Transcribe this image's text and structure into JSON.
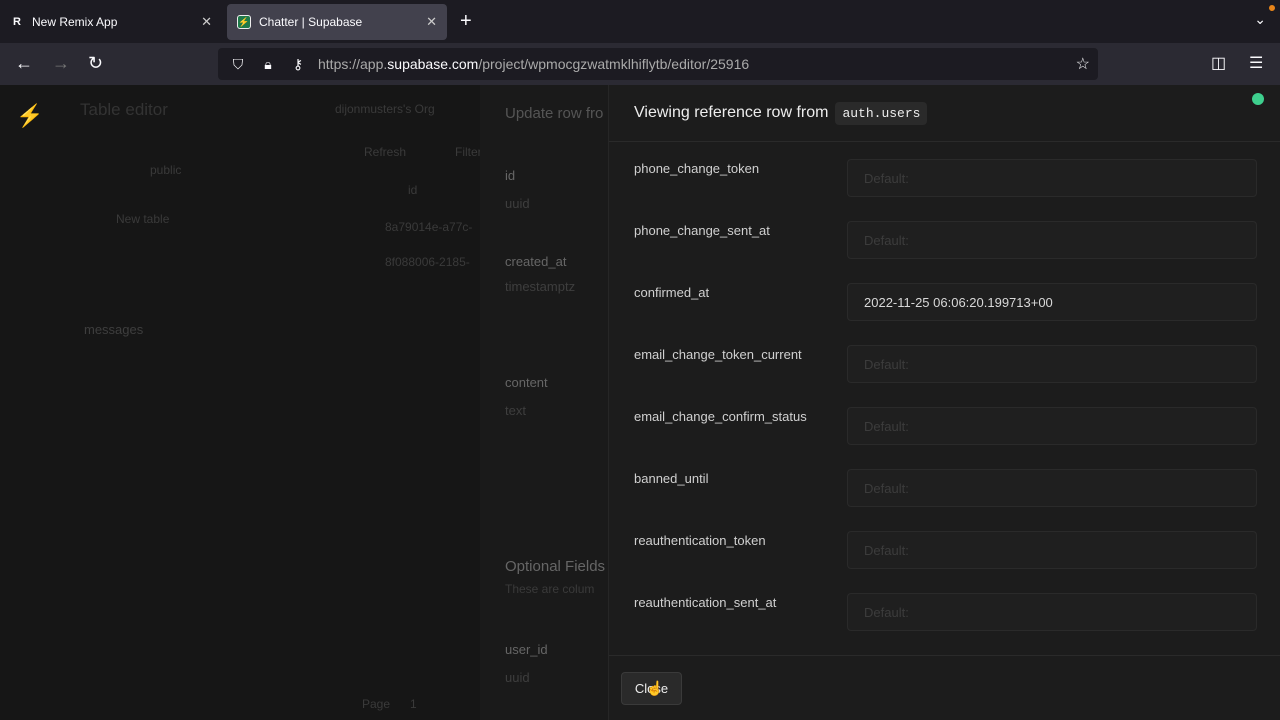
{
  "browser": {
    "tabs": [
      {
        "title": "New Remix App",
        "icon": "remix-logo"
      },
      {
        "title": "Chatter | Supabase",
        "icon": "supabase-logo",
        "active": true
      }
    ],
    "url_prefix": "https://app.",
    "url_domain": "supabase.com",
    "url_path": "/project/wpmocgzwatmklhiflytb/editor/25916"
  },
  "background": {
    "title": "Table editor",
    "org": "dijonmusters's Org",
    "refresh": "Refresh",
    "filter": "Filter",
    "schema": "public",
    "new_table": "New table",
    "table": "messages",
    "col": "id",
    "row1": "8a79014e-a77c-",
    "row2": "8f088006-2185-",
    "page_label": "Page",
    "page_num": "1"
  },
  "update_panel": {
    "title": "Update row fro",
    "fields": [
      {
        "name": "id",
        "type": "uuid"
      },
      {
        "name": "created_at",
        "type": "timestamptz"
      },
      {
        "name": "content",
        "type": "text"
      }
    ],
    "optional_title": "Optional Fields",
    "optional_desc": "These are colum",
    "optional_field": {
      "name": "user_id",
      "type": "uuid"
    }
  },
  "reference_panel": {
    "title": "Viewing reference row from",
    "table": "auth.users",
    "status_color": "#3ecf8e",
    "rows": [
      {
        "label": "phone_change_token",
        "value": "",
        "placeholder": "Default:"
      },
      {
        "label": "phone_change_sent_at",
        "value": "",
        "placeholder": "Default:"
      },
      {
        "label": "confirmed_at",
        "value": "2022-11-25 06:06:20.199713+00",
        "placeholder": "Default:"
      },
      {
        "label": "email_change_token_current",
        "value": "",
        "placeholder": "Default:"
      },
      {
        "label": "email_change_confirm_status",
        "value": "",
        "placeholder": "Default:"
      },
      {
        "label": "banned_until",
        "value": "",
        "placeholder": "Default:"
      },
      {
        "label": "reauthentication_token",
        "value": "",
        "placeholder": "Default:"
      },
      {
        "label": "reauthentication_sent_at",
        "value": "",
        "placeholder": "Default:"
      }
    ],
    "close_label": "Close"
  }
}
